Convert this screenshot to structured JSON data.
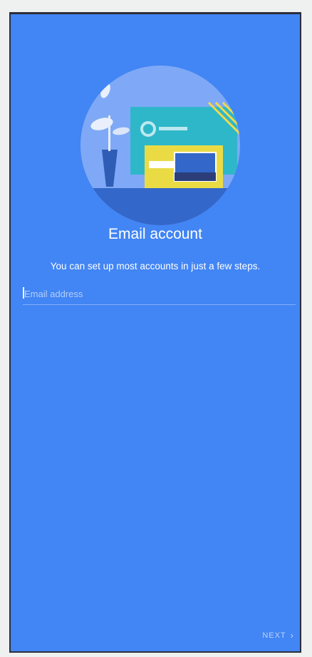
{
  "screen": {
    "title": "Email account",
    "subtitle": "You can set up most accounts in just a few steps.",
    "email_field": {
      "value": "",
      "placeholder": "Email address"
    },
    "next_label": "NEXT",
    "next_icon": "chevron-right-icon"
  },
  "colors": {
    "background": "#4285f4",
    "text": "#ffffff"
  }
}
